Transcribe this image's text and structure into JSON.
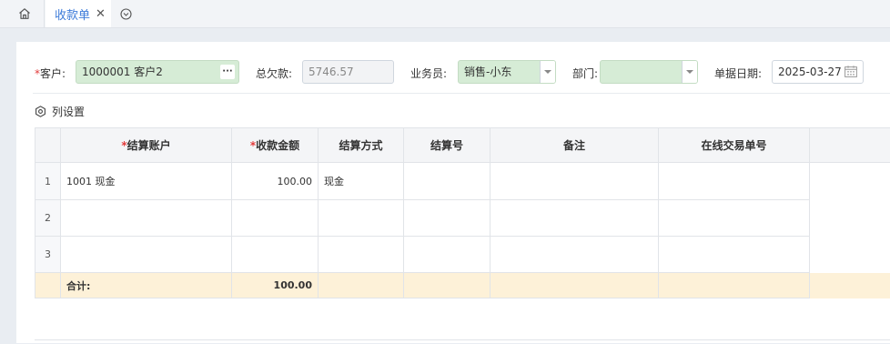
{
  "tabs": {
    "active_label": "收款单"
  },
  "form": {
    "customer": {
      "label": "客户:",
      "value": "1000001 客户2"
    },
    "total_debt": {
      "label": "总欠款:",
      "value": "5746.57"
    },
    "salesman": {
      "label": "业务员:",
      "value": "销售-小东"
    },
    "department": {
      "label": "部门:",
      "value": ""
    },
    "doc_date": {
      "label": "单据日期:",
      "value": "2025-03-27"
    },
    "more_symbol": "···"
  },
  "column_settings_label": "列设置",
  "table": {
    "headers": {
      "account": "结算账户",
      "amount": "收款金额",
      "method": "结算方式",
      "number": "结算号",
      "remark": "备注",
      "online_no": "在线交易单号"
    },
    "rows": [
      {
        "idx": "1",
        "account": "1001 现金",
        "amount": "100.00",
        "method": "现金",
        "number": "",
        "remark": "",
        "online_no": ""
      },
      {
        "idx": "2",
        "account": "",
        "amount": "",
        "method": "",
        "number": "",
        "remark": "",
        "online_no": ""
      },
      {
        "idx": "3",
        "account": "",
        "amount": "",
        "method": "",
        "number": "",
        "remark": "",
        "online_no": ""
      }
    ],
    "total": {
      "label": "合计:",
      "amount": "100.00"
    }
  },
  "colors": {
    "accent": "#3d7bd9",
    "required": "#e23b3b",
    "field_green": "#d6ecd6",
    "total_row": "#fdf1d8"
  },
  "icons": {
    "home": "home-icon",
    "close": "close-icon",
    "tab_menu": "chevron-circle-down-icon",
    "column_settings": "gear-icon",
    "calendar": "calendar-icon",
    "dropdown": "caret-down-icon"
  }
}
